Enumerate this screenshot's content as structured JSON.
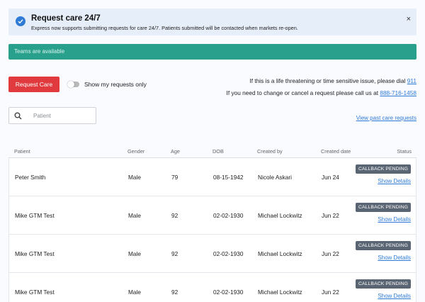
{
  "alert": {
    "title": "Request care 24/7",
    "message": "Express now supports submitting requests for care 24/7. Patients submitted will be contacted when markets re-open.",
    "close": "×"
  },
  "teams_banner": "Teams are available",
  "actions": {
    "request_label": "Request Care",
    "toggle_label": "Show my requests only",
    "toggle_on": false
  },
  "contact": {
    "emergency_text": "If this is a life threatening or time sensitive issue, please dial",
    "emergency_number": "911",
    "change_text": "If you need to change or cancel a request please call us at",
    "change_number": "888-716-1458"
  },
  "search": {
    "placeholder": "Patient",
    "value": ""
  },
  "past_link": "View past care requests",
  "table": {
    "headers": {
      "patient": "Patient",
      "gender": "Gender",
      "age": "Age",
      "dob": "DOB",
      "created_by": "Created by",
      "created_date": "Created date",
      "status": "Status"
    },
    "rows": [
      {
        "patient": "Peter Smith",
        "gender": "Male",
        "age": "79",
        "dob": "08-15-1942",
        "created_by": "Nicole Askari",
        "created_date": "Jun 24",
        "status": "CALLBACK PENDING",
        "details": "Show Details"
      },
      {
        "patient": "Mike GTM Test",
        "gender": "Male",
        "age": "92",
        "dob": "02-02-1930",
        "created_by": "Michael Lockwitz",
        "created_date": "Jun 22",
        "status": "CALLBACK PENDING",
        "details": "Show Details"
      },
      {
        "patient": "Mike GTM Test",
        "gender": "Male",
        "age": "92",
        "dob": "02-02-1930",
        "created_by": "Michael Lockwitz",
        "created_date": "Jun 22",
        "status": "CALLBACK PENDING",
        "details": "Show Details"
      },
      {
        "patient": "Mike GTM Test",
        "gender": "Male",
        "age": "92",
        "dob": "02-02-1930",
        "created_by": "Michael Lockwitz",
        "created_date": "Jun 22",
        "status": "CALLBACK PENDING",
        "details": "Show Details"
      }
    ]
  },
  "colors": {
    "alert_bg": "#e6eef9",
    "info_icon": "#2f7bd6",
    "teams_banner": "#28a08c",
    "primary_button": "#e0393e",
    "link": "#2f7bd6",
    "status_badge": "#5a6573"
  },
  "icons": {
    "alert": "check-circle-icon",
    "close": "close-icon",
    "search": "search-icon"
  }
}
